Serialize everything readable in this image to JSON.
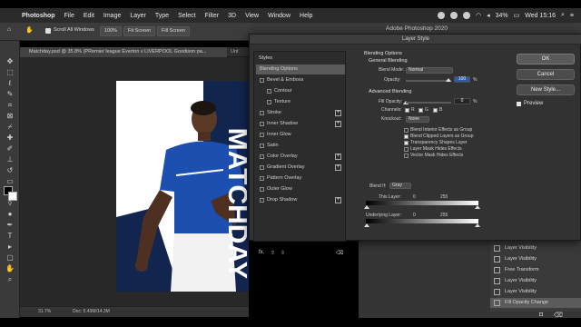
{
  "menubar": {
    "app": "Photoshop",
    "items": [
      "File",
      "Edit",
      "Image",
      "Layer",
      "Type",
      "Select",
      "Filter",
      "3D",
      "View",
      "Window",
      "Help"
    ],
    "battery": "34%",
    "clock": "Wed 15:16"
  },
  "options_bar": {
    "scroll_all": "Scroll All Windows",
    "zoom": "100%",
    "fit_screen": "Fit Screen",
    "fill_screen": "Fill Screen"
  },
  "window_title": "Adobe Photoshop 2020",
  "document": {
    "tab": "Matchday.psd @ 35.8% (PRemier league Everton v LIVERPOOL Goodison pa...",
    "tab2": "Unt",
    "artboard_text": "MATCHDAY",
    "zoom_status": "31.7%",
    "doc_status": "Doc: 5.49M/14.3M"
  },
  "dialog": {
    "title": "Layer Style",
    "styles_header": "Styles",
    "styles": [
      {
        "label": "Blending Options",
        "checkbox": false,
        "plus": false,
        "selected": true
      },
      {
        "label": "Bevel & Emboss",
        "checkbox": true,
        "plus": false
      },
      {
        "label": "Contour",
        "checkbox": true,
        "plus": false,
        "indent": true
      },
      {
        "label": "Texture",
        "checkbox": true,
        "plus": false,
        "indent": true
      },
      {
        "label": "Stroke",
        "checkbox": true,
        "plus": true
      },
      {
        "label": "Inner Shadow",
        "checkbox": true,
        "plus": true
      },
      {
        "label": "Inner Glow",
        "checkbox": true,
        "plus": false
      },
      {
        "label": "Satin",
        "checkbox": true,
        "plus": false
      },
      {
        "label": "Color Overlay",
        "checkbox": true,
        "plus": true
      },
      {
        "label": "Gradient Overlay",
        "checkbox": true,
        "plus": true
      },
      {
        "label": "Pattern Overlay",
        "checkbox": true,
        "plus": false
      },
      {
        "label": "Outer Glow",
        "checkbox": true,
        "plus": false
      },
      {
        "label": "Drop Shadow",
        "checkbox": true,
        "plus": true
      }
    ],
    "fx": "fx.",
    "blending": {
      "header": "Blending Options",
      "general": "General Blending",
      "blend_mode_label": "Blend Mode:",
      "blend_mode": "Normal",
      "opacity_label": "Opacity:",
      "opacity": "100",
      "opacity_unit": "%",
      "advanced": "Advanced Blending",
      "fill_opacity_label": "Fill Opacity:",
      "fill_opacity": "0",
      "fill_unit": "%",
      "channels_label": "Channels:",
      "channels": [
        "R",
        "G",
        "B"
      ],
      "knockout_label": "Knockout:",
      "knockout": "None",
      "checks": [
        {
          "label": "Blend Interior Effects as Group",
          "on": false
        },
        {
          "label": "Blend Clipped Layers as Group",
          "on": true
        },
        {
          "label": "Transparency Shapes Layer",
          "on": true
        },
        {
          "label": "Layer Mask Hides Effects",
          "on": false
        },
        {
          "label": "Vector Mask Hides Effects",
          "on": false
        }
      ],
      "blend_if_label": "Blend If:",
      "blend_if": "Gray",
      "this_layer_label": "This Layer:",
      "this_low": "0",
      "this_high": "255",
      "underlying_label": "Underlying Layer:",
      "under_low": "0",
      "under_high": "255"
    },
    "buttons": {
      "ok": "OK",
      "cancel": "Cancel",
      "new_style": "New Style...",
      "preview": "Preview"
    }
  },
  "history": {
    "rows": [
      {
        "label": "Layer Visibility",
        "selected": false
      },
      {
        "label": "Layer Visibility",
        "selected": false
      },
      {
        "label": "Free Transform",
        "selected": false
      },
      {
        "label": "Layer Visibility",
        "selected": false
      },
      {
        "label": "Layer Visibility",
        "selected": false
      },
      {
        "label": "Fill Opacity Change",
        "selected": true
      }
    ]
  }
}
